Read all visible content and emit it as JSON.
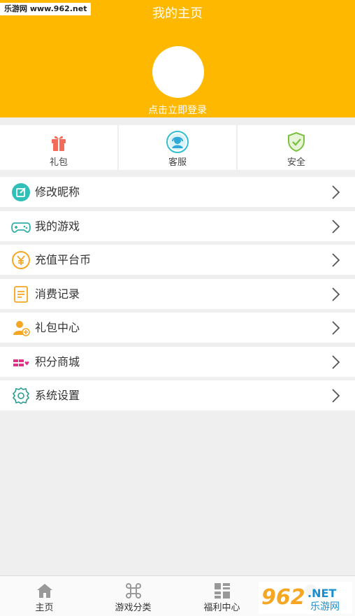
{
  "watermark_top": "乐游网 www.962.net",
  "header": {
    "title": "我的主页",
    "login_text": "点击立即登录"
  },
  "quick": [
    {
      "label": "礼包",
      "icon": "gift-icon"
    },
    {
      "label": "客服",
      "icon": "customer-service-icon"
    },
    {
      "label": "安全",
      "icon": "shield-check-icon"
    }
  ],
  "menu": [
    {
      "label": "修改昵称",
      "icon": "edit-icon"
    },
    {
      "label": "我的游戏",
      "icon": "gamepad-icon"
    },
    {
      "label": "充值平台币",
      "icon": "yen-coin-icon"
    },
    {
      "label": "消费记录",
      "icon": "record-icon"
    },
    {
      "label": "礼包中心",
      "icon": "user-gift-icon"
    },
    {
      "label": "积分商城",
      "icon": "points-mall-icon"
    },
    {
      "label": "系统设置",
      "icon": "settings-icon"
    }
  ],
  "tabs": [
    {
      "label": "主页",
      "icon": "home-icon"
    },
    {
      "label": "游戏分类",
      "icon": "command-icon"
    },
    {
      "label": "福利中心",
      "icon": "grid-list-icon"
    },
    {
      "label": "",
      "icon": "tab-four-icon"
    }
  ],
  "watermark_bottom": {
    "num": "962",
    "net": ".NET",
    "cn": "乐游网"
  },
  "colors": {
    "accent": "#ffb800",
    "teal": "#30c0b8",
    "orange": "#f5a623"
  }
}
